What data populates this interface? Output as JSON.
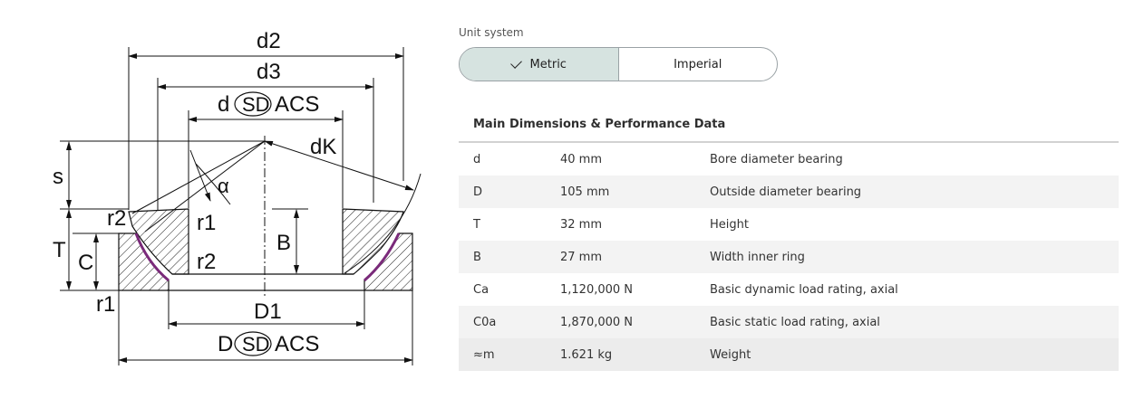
{
  "drawing": {
    "labels": {
      "d2": "d2",
      "d3": "d3",
      "d_sd": "d",
      "sd": "SD",
      "acs": "ACS",
      "dk": "dK",
      "alpha": "α",
      "s": "s",
      "T": "T",
      "C": "C",
      "B": "B",
      "r1_top": "r1",
      "r2_left": "r2",
      "r2_inner": "r2",
      "r1_bottom": "r1",
      "D1": "D1",
      "D_sd": "D"
    }
  },
  "unit_system": {
    "label": "Unit system",
    "options": [
      {
        "label": "Metric",
        "selected": true
      },
      {
        "label": "Imperial",
        "selected": false
      }
    ]
  },
  "table": {
    "title": "Main Dimensions & Performance Data",
    "rows": [
      {
        "symbol": "d",
        "value": "40 mm",
        "description": "Bore diameter bearing"
      },
      {
        "symbol": "D",
        "value": "105 mm",
        "description": "Outside diameter bearing"
      },
      {
        "symbol": "T",
        "value": "32 mm",
        "description": "Height"
      },
      {
        "symbol": "B",
        "value": "27 mm",
        "description": "Width inner ring"
      },
      {
        "symbol": "Ca",
        "value": "1,120,000 N",
        "description": "Basic dynamic load rating, axial"
      },
      {
        "symbol": "C0a",
        "value": "1,870,000 N",
        "description": "Basic static load rating, axial"
      },
      {
        "symbol": "≈m",
        "value": "1.621 kg",
        "description": "Weight"
      }
    ]
  }
}
